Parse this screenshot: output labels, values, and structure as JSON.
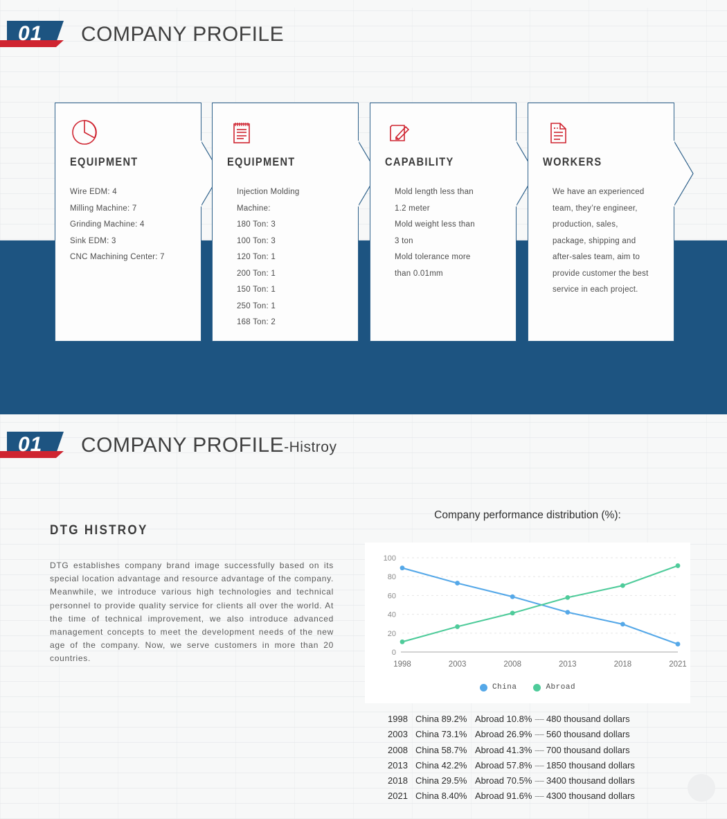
{
  "sections": [
    {
      "badge_number": "01",
      "title": "COMPANY PROFILE",
      "suffix": ""
    },
    {
      "badge_number": "01",
      "title": "COMPANY PROFILE",
      "suffix": "-Histroy"
    }
  ],
  "colors": {
    "brand_blue": "#1d5481",
    "brand_red": "#cf2430",
    "card_border": "#2d608a",
    "series_china": "#55a8e8",
    "series_abroad": "#4ecb9a",
    "page_bg": "#f7f8f8"
  },
  "cards": [
    {
      "icon": "pie-chart-icon",
      "title": "EQUIPMENT",
      "lines": [
        "Wire EDM: 4",
        "Milling Machine: 7",
        "Grinding Machine: 4",
        "Sink EDM: 3",
        "CNC Machining Center: 7"
      ]
    },
    {
      "icon": "notepad-icon",
      "title": "EQUIPMENT",
      "lines": [
        "Injection Molding",
        "Machine:",
        "180 Ton: 3",
        "100 Ton: 3",
        "120 Ton: 1",
        "200 Ton: 1",
        "150 Ton: 1",
        "250 Ton: 1",
        "168 Ton: 2"
      ]
    },
    {
      "icon": "pencil-square-icon",
      "title": "CAPABILITY",
      "lines": [
        "Mold length less than",
        "1.2 meter",
        "Mold weight less than",
        "3 ton",
        "Mold tolerance more",
        "than 0.01mm"
      ]
    },
    {
      "icon": "document-icon",
      "title": "WORKERS",
      "lines": [
        "We have an experienced",
        "team, they’re engineer,",
        "production, sales,",
        "package, shipping and",
        "after-sales team, aim to",
        "provide customer the best",
        "service in each project."
      ]
    }
  ],
  "history": {
    "heading": "DTG  HISTROY",
    "body": "DTG establishes company brand image successfully based on its special location advantage and resource advantage of the company. Meanwhile, we introduce various high technologies and technical personnel to provide quality service for clients all over the world. At the time of technical improvement, we also introduce advanced management concepts to meet the development needs of the new age of the company. Now, we serve customers in more than 20 countries."
  },
  "chart_data": {
    "type": "line",
    "title": "Company performance distribution (%):",
    "categories": [
      "1998",
      "2003",
      "2008",
      "2013",
      "2018",
      "2021"
    ],
    "series": [
      {
        "name": "China",
        "color": "#55a8e8",
        "values": [
          89.2,
          73.1,
          58.7,
          42.2,
          29.5,
          8.4
        ]
      },
      {
        "name": "Abroad",
        "color": "#4ecb9a",
        "values": [
          10.8,
          26.9,
          41.3,
          57.8,
          70.5,
          91.6
        ]
      }
    ],
    "xlabel": "",
    "ylabel": "",
    "ylim": [
      0,
      100
    ],
    "yticks": [
      0,
      20,
      40,
      60,
      80,
      100
    ],
    "grid": true,
    "legend_position": "bottom"
  },
  "performance_rows": [
    {
      "year": "1998",
      "china": "China 89.2%",
      "abroad": "Abroad 10.8%",
      "dash": "----",
      "revenue": "480 thousand dollars"
    },
    {
      "year": "2003",
      "china": "China 73.1%",
      "abroad": "Abroad 26.9%",
      "dash": "----",
      "revenue": "560 thousand dollars"
    },
    {
      "year": "2008",
      "china": "China 58.7%",
      "abroad": "Abroad 41.3%",
      "dash": "----",
      "revenue": "700 thousand dollars"
    },
    {
      "year": "2013",
      "china": "China 42.2%",
      "abroad": "Abroad 57.8%",
      "dash": "----",
      "revenue": "1850 thousand dollars"
    },
    {
      "year": "2018",
      "china": "China 29.5%",
      "abroad": "Abroad 70.5%",
      "dash": "----",
      "revenue": "3400 thousand dollars"
    },
    {
      "year": "2021",
      "china": "China 8.40%",
      "abroad": "Abroad 91.6%",
      "dash": "----",
      "revenue": "4300 thousand dollars"
    }
  ]
}
